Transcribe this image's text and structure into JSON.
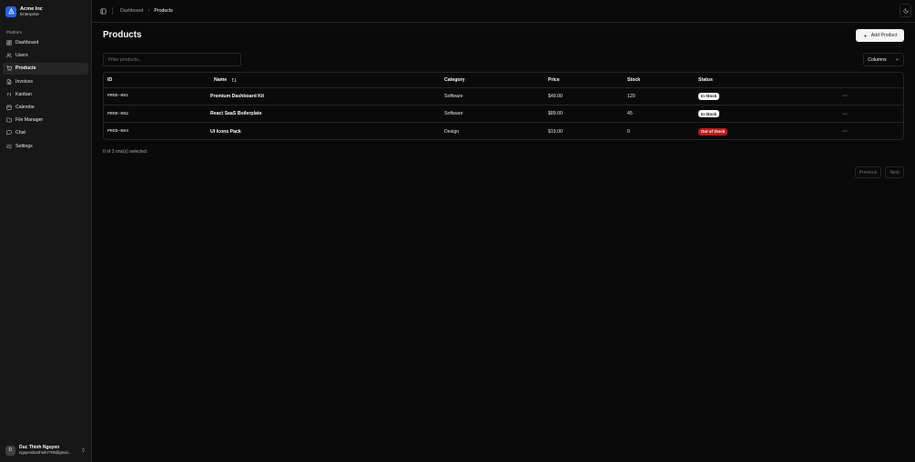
{
  "brand": {
    "name": "Acme Inc",
    "plan": "Enterprise",
    "logo_color": "#2563eb"
  },
  "sidebar": {
    "group_label": "Platform",
    "items": [
      {
        "label": "Dashboard",
        "icon": "layout-dashboard-icon",
        "active": false
      },
      {
        "label": "Users",
        "icon": "users-icon",
        "active": false
      },
      {
        "label": "Products",
        "icon": "shopping-cart-icon",
        "active": true
      },
      {
        "label": "Invoices",
        "icon": "file-text-icon",
        "active": false
      },
      {
        "label": "Kanban",
        "icon": "kanban-icon",
        "active": false
      },
      {
        "label": "Calendar",
        "icon": "calendar-icon",
        "active": false
      },
      {
        "label": "File Manager",
        "icon": "folder-icon",
        "active": false
      },
      {
        "label": "Chat",
        "icon": "message-square-icon",
        "active": false
      },
      {
        "label": "Settings",
        "icon": "settings-icon",
        "active": false
      }
    ]
  },
  "user": {
    "initial": "D",
    "name": "Duc Thinh Nguyen",
    "email": "nguyenducthinh7705@gmai..."
  },
  "breadcrumb": {
    "parent": "Dashboard",
    "current": "Products"
  },
  "page": {
    "title": "Products",
    "add_button": "Add Product"
  },
  "filter": {
    "placeholder": "Filter products...",
    "value": ""
  },
  "columns_button": "Columns",
  "table": {
    "headers": {
      "id": "ID",
      "name": "Name",
      "category": "Category",
      "price": "Price",
      "stock": "Stock",
      "status": "Status"
    },
    "rows": [
      {
        "id": "PROD-001",
        "name": "Premium Dashboard Kit",
        "category": "Software",
        "price": "$49.00",
        "stock": "120",
        "status": "In Stock",
        "status_type": "in"
      },
      {
        "id": "PROD-002",
        "name": "React SaaS Boilerplate",
        "category": "Software",
        "price": "$89.00",
        "stock": "45",
        "status": "In Stock",
        "status_type": "in"
      },
      {
        "id": "PROD-003",
        "name": "UI Icons Pack",
        "category": "Design",
        "price": "$19.00",
        "stock": "0",
        "status": "Out of Stock",
        "status_type": "out"
      }
    ]
  },
  "selection_text": "0 of 3 row(s) selected.",
  "pager": {
    "previous": "Previous",
    "next": "Next"
  },
  "colors": {
    "background": "#0a0a0a",
    "sidebar": "#171717",
    "border": "#262626",
    "danger": "#b91c1c"
  }
}
